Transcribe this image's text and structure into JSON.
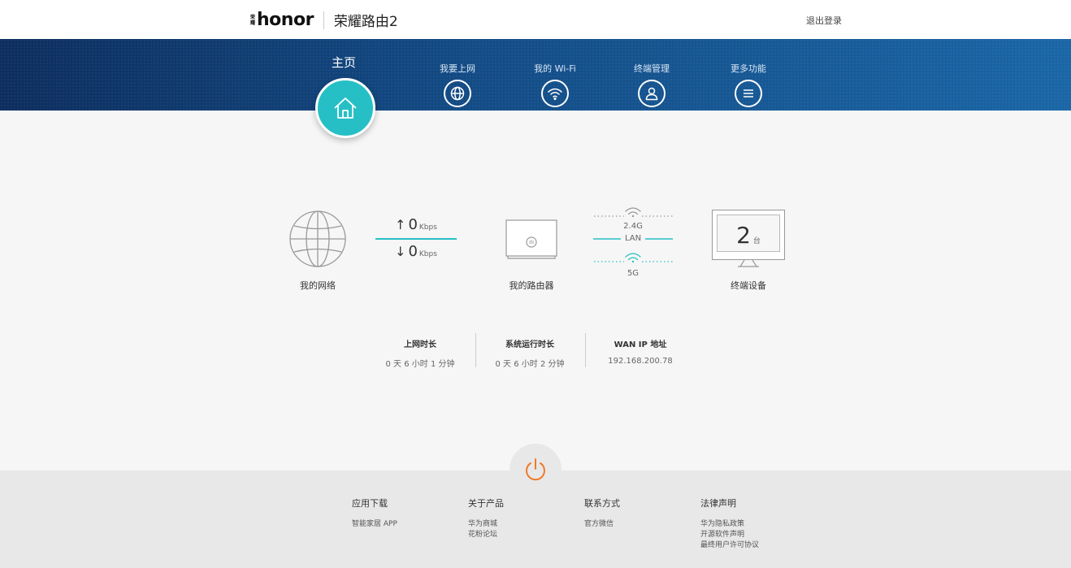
{
  "header": {
    "logo_mark": [
      "荣",
      "耀"
    ],
    "logo_text": "honor",
    "product_name": "荣耀路由2",
    "logout_label": "退出登录"
  },
  "nav": {
    "home_label": "主页",
    "items": [
      {
        "label": "我要上网",
        "icon": "globe-icon"
      },
      {
        "label": "我的 Wi-Fi",
        "icon": "wifi-icon"
      },
      {
        "label": "终端管理",
        "icon": "user-icon"
      },
      {
        "label": "更多功能",
        "icon": "menu-icon"
      }
    ]
  },
  "topology": {
    "network_label": "我的网络",
    "upload_value": "0",
    "download_value": "0",
    "speed_unit": "Kbps",
    "router_label": "我的路由器",
    "band_24": "2.4G",
    "band_lan": "LAN",
    "band_5": "5G",
    "device_count": "2",
    "device_unit": "台",
    "devices_label": "终端设备"
  },
  "stats": [
    {
      "title": "上网时长",
      "value": "0 天 6 小时 1 分钟"
    },
    {
      "title": "系统运行时长",
      "value": "0 天 6 小时 2 分钟"
    },
    {
      "title": "WAN IP 地址",
      "value": "192.168.200.78"
    }
  ],
  "footer": {
    "columns": [
      {
        "title": "应用下载",
        "links": [
          "智能家居 APP"
        ]
      },
      {
        "title": "关于产品",
        "links": [
          "华为商城",
          "花粉论坛"
        ]
      },
      {
        "title": "联系方式",
        "links": [
          "官方微信"
        ]
      },
      {
        "title": "法律声明",
        "links": [
          "华为隐私政策",
          "开源软件声明",
          "最终用户许可协议"
        ]
      }
    ]
  },
  "colors": {
    "accent": "#27bfc6",
    "power": "#f07a2a",
    "nav_dark": "#0d2e5e",
    "nav_light": "#1a66a6"
  }
}
